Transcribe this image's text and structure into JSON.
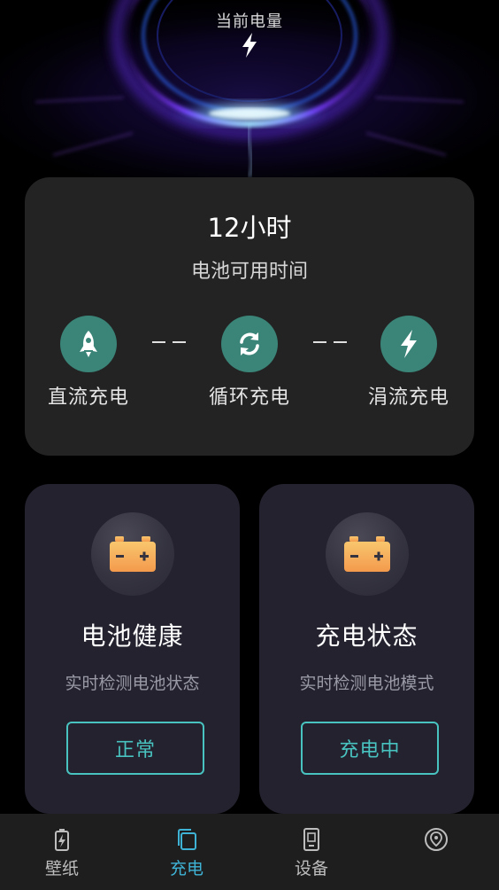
{
  "colors": {
    "accent": "#49c3c0",
    "nav_active": "#3fb3d6",
    "mode_icon_bg": "#3a8478",
    "card_bg": "#232323",
    "info_card_bg": "#23222e",
    "battery_gradient_top": "#f8c66d",
    "battery_gradient_bottom": "#f49a4d"
  },
  "hero": {
    "label": "当前电量",
    "icon": "lightning-bolt-icon"
  },
  "time_card": {
    "value": "12小时",
    "subtitle": "电池可用时间",
    "modes": [
      {
        "label": "直流充电",
        "icon": "rocket-icon"
      },
      {
        "label": "循环充电",
        "icon": "cycle-arrows-icon"
      },
      {
        "label": "涓流充电",
        "icon": "lightning-bolt-icon"
      }
    ]
  },
  "cards": [
    {
      "title": "电池健康",
      "subtitle": "实时检测电池状态",
      "button": "正常",
      "icon": "battery-icon"
    },
    {
      "title": "充电状态",
      "subtitle": "实时检测电池模式",
      "button": "充电中",
      "icon": "battery-icon"
    }
  ],
  "nav": {
    "items": [
      {
        "label": "壁纸",
        "icon": "battery-charging-icon",
        "active": false
      },
      {
        "label": "充电",
        "icon": "layers-icon",
        "active": true
      },
      {
        "label": "设备",
        "icon": "device-icon",
        "active": false
      },
      {
        "label": "",
        "icon": "location-pin-icon",
        "active": false
      }
    ]
  }
}
